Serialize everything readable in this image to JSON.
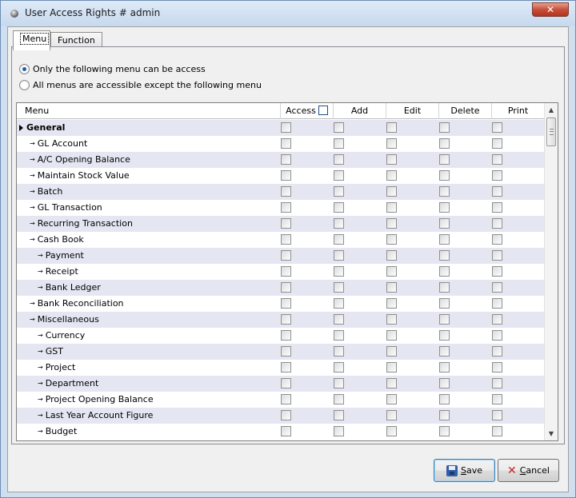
{
  "window": {
    "title": "User Access Rights # admin",
    "close_glyph": "✕"
  },
  "tabs": [
    {
      "label": "Menu",
      "active": true
    },
    {
      "label": "Function",
      "active": false
    }
  ],
  "access_mode": {
    "options": [
      {
        "label": "Only the following menu can be access",
        "checked": true
      },
      {
        "label": "All menus are accessible except the following menu",
        "checked": false
      }
    ]
  },
  "grid": {
    "columns": {
      "menu": "Menu",
      "access": "Access",
      "add": "Add",
      "edit": "Edit",
      "delete": "Delete",
      "print": "Print"
    },
    "header_access_checked": false,
    "rows": [
      {
        "label": "General",
        "level": 0,
        "current": true
      },
      {
        "label": "GL Account",
        "level": 1
      },
      {
        "label": "A/C Opening Balance",
        "level": 1
      },
      {
        "label": "Maintain Stock Value",
        "level": 1
      },
      {
        "label": "Batch",
        "level": 1
      },
      {
        "label": "GL Transaction",
        "level": 1
      },
      {
        "label": "Recurring Transaction",
        "level": 1
      },
      {
        "label": "Cash Book",
        "level": 1
      },
      {
        "label": "Payment",
        "level": 2
      },
      {
        "label": "Receipt",
        "level": 2
      },
      {
        "label": "Bank Ledger",
        "level": 2
      },
      {
        "label": "Bank Reconciliation",
        "level": 1
      },
      {
        "label": "Miscellaneous",
        "level": 1
      },
      {
        "label": "Currency",
        "level": 2
      },
      {
        "label": "GST",
        "level": 2
      },
      {
        "label": "Project",
        "level": 2
      },
      {
        "label": "Department",
        "level": 2
      },
      {
        "label": "Project Opening Balance",
        "level": 2
      },
      {
        "label": "Last Year Account Figure",
        "level": 2
      },
      {
        "label": "Budget",
        "level": 2
      }
    ]
  },
  "buttons": {
    "save": {
      "prefix": "",
      "accel": "S",
      "rest": "ave"
    },
    "cancel": {
      "prefix": "",
      "accel": "C",
      "rest": "ancel"
    }
  }
}
